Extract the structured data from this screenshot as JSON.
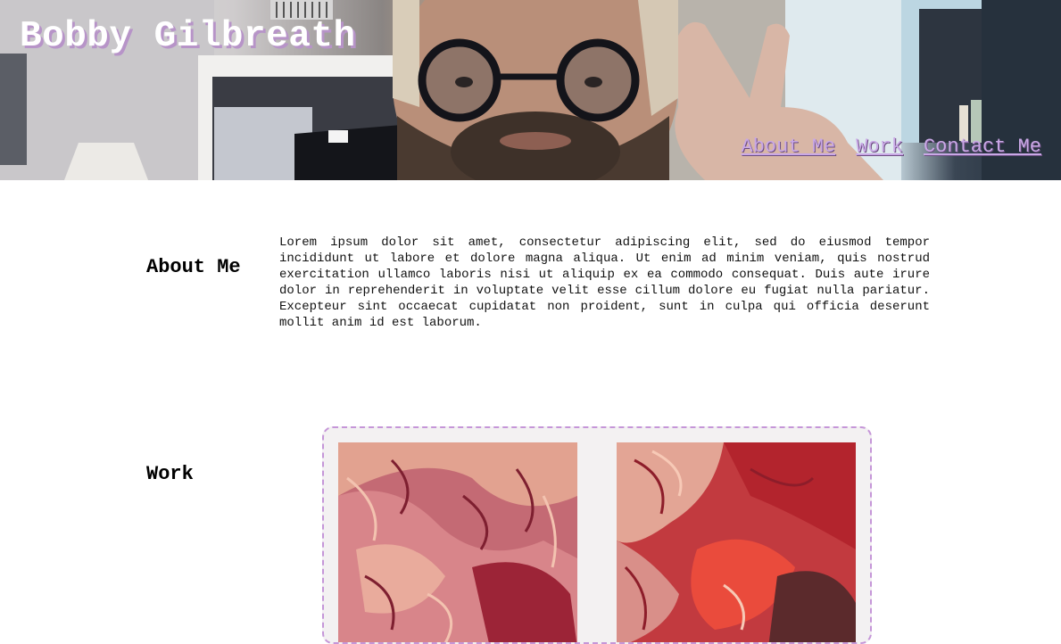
{
  "header": {
    "site_title": "Bobby Gilbreath",
    "nav": [
      {
        "label": "About Me"
      },
      {
        "label": "Work"
      },
      {
        "label": "Contact Me"
      }
    ]
  },
  "about": {
    "heading": "About Me",
    "body": "Lorem ipsum dolor sit amet, consectetur adipiscing elit, sed do eiusmod tempor incididunt ut labore et dolore magna aliqua. Ut enim ad minim veniam, quis nostrud exercitation ullamco laboris nisi ut aliquip ex ea commodo consequat. Duis aute irure dolor in reprehenderit in voluptate velit esse cillum dolore eu fugiat nulla pariatur. Excepteur sint occaecat cupidatat non proident, sunt in culpa qui officia deserunt mollit anim id est laborum."
  },
  "work": {
    "heading": "Work"
  },
  "colors": {
    "accent": "#c9a8e6",
    "title_shadow": "#b794c8",
    "frame_border": "#c596d8"
  }
}
